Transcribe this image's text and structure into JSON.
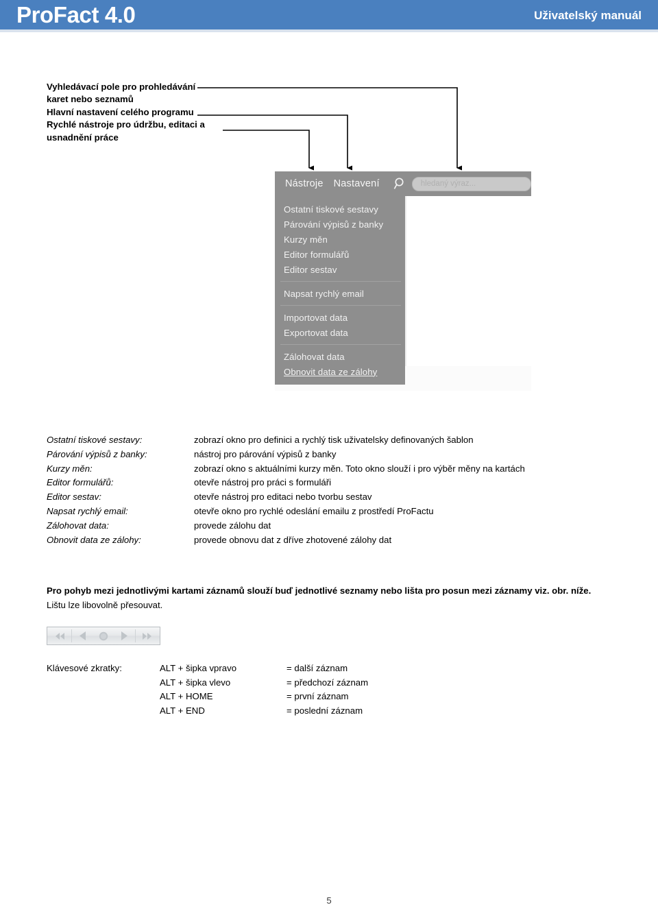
{
  "header": {
    "title": "ProFact 4.0",
    "subtitle": "Uživatelský manuál",
    "band_color": "#4a80bf",
    "rule_color": "#d9e2ee"
  },
  "callouts": [
    "Vyhledávací pole pro prohledávání",
    "karet nebo seznamů",
    "Hlavní nastavení celého programu",
    "Rychlé nástroje pro údržbu, editaci a",
    "usnadnění práce"
  ],
  "app_screenshot": {
    "toolbar": {
      "items": [
        "Nástroje",
        "Nastavení"
      ],
      "search_icon": "magnifier-icon",
      "search_placeholder": "hledaný výraz...",
      "background": "#8e8e8e"
    },
    "menu_groups": [
      {
        "items": [
          {
            "label": "Ostatní tiskové sestavy",
            "underlined": false
          },
          {
            "label": "Párování výpisů z banky",
            "underlined": false
          },
          {
            "label": "Kurzy měn",
            "underlined": false
          },
          {
            "label": "Editor formulářů",
            "underlined": false
          },
          {
            "label": "Editor sestav",
            "underlined": false
          }
        ]
      },
      {
        "items": [
          {
            "label": "Napsat rychlý email",
            "underlined": false
          }
        ]
      },
      {
        "items": [
          {
            "label": "Importovat data",
            "underlined": false
          },
          {
            "label": "Exportovat data",
            "underlined": false
          }
        ]
      },
      {
        "items": [
          {
            "label": "Zálohovat data",
            "underlined": false
          },
          {
            "label": "Obnovit data ze zálohy",
            "underlined": true
          }
        ]
      }
    ]
  },
  "definitions": [
    {
      "term": "Ostatní tiskové sestavy:",
      "desc": "zobrazí okno pro definici a rychlý tisk uživatelsky definovaných šablon"
    },
    {
      "term": "Párování výpisů z banky:",
      "desc": "nástroj pro párování výpisů z banky"
    },
    {
      "term": "Kurzy měn:",
      "desc": "zobrazí okno s aktuálními kurzy měn. Toto okno slouží i pro výběr měny na kartách"
    },
    {
      "term": "Editor formulářů:",
      "desc": "otevře nástroj pro práci s formuláři"
    },
    {
      "term": "Editor sestav:",
      "desc": "otevře nástroj pro editaci nebo tvorbu sestav"
    },
    {
      "term": "Napsat rychlý email:",
      "desc": "otevře okno pro rychlé odeslání emailu z prostředí ProFactu"
    },
    {
      "term": "Zálohovat data:",
      "desc": "provede zálohu dat"
    },
    {
      "term": "Obnovit data ze zálohy:",
      "desc": "provede obnovu dat z dříve zhotovené zálohy dat"
    }
  ],
  "paragraph": {
    "bold_line": "Pro pohyb mezi jednotlivými kartami záznamů slouží buď jednotlivé seznamy nebo lišta pro posun mezi záznamy viz. obr. níže.",
    "normal_line": "Lištu lze libovolně přesouvat."
  },
  "navigator": {
    "buttons": [
      "first-record-icon",
      "previous-record-icon",
      "record-handle-icon",
      "next-record-icon",
      "last-record-icon"
    ]
  },
  "shortcuts": {
    "label": "Klávesové zkratky:",
    "rows": [
      {
        "key": "ALT + šipka vpravo",
        "value": "= další záznam"
      },
      {
        "key": "ALT + šipka vlevo",
        "value": "= předchozí záznam"
      },
      {
        "key": "ALT + HOME",
        "value": "= první záznam"
      },
      {
        "key": "ALT + END",
        "value": "= poslední záznam"
      }
    ]
  },
  "footer": {
    "page_number": "5"
  }
}
